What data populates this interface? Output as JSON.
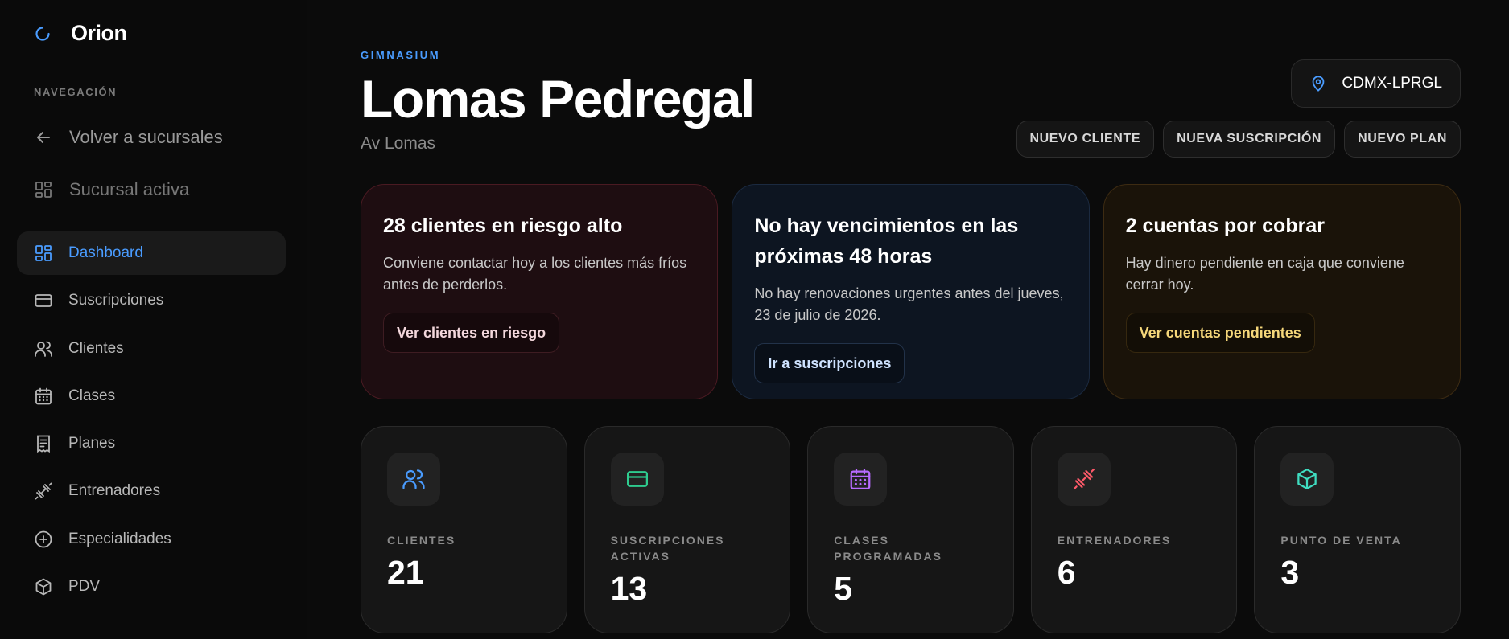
{
  "brand": {
    "name": "Orion",
    "icon": "loader-ring-icon",
    "accent": "#4a9cff"
  },
  "sidebar": {
    "section_label": "NAVEGACIÓN",
    "back_label": "Volver a sucursales",
    "active_branch_label": "Sucursal activa",
    "items": [
      {
        "label": "Dashboard",
        "icon": "dashboard-icon",
        "active": true
      },
      {
        "label": "Suscripciones",
        "icon": "credit-card-icon",
        "active": false
      },
      {
        "label": "Clientes",
        "icon": "users-icon",
        "active": false
      },
      {
        "label": "Clases",
        "icon": "calendar-icon",
        "active": false
      },
      {
        "label": "Planes",
        "icon": "receipt-icon",
        "active": false
      },
      {
        "label": "Entrenadores",
        "icon": "dumbbell-icon",
        "active": false
      },
      {
        "label": "Especialidades",
        "icon": "plus-circle-icon",
        "active": false
      },
      {
        "label": "PDV",
        "icon": "box-icon",
        "active": false
      }
    ]
  },
  "header": {
    "eyebrow": "GIMNASIUM",
    "title": "Lomas Pedregal",
    "subtitle": "Av Lomas",
    "branch_code": "CDMX-LPRGL",
    "actions": {
      "new_client": "NUEVO CLIENTE",
      "new_subscription": "NUEVA SUSCRIPCIÓN",
      "new_plan": "NUEVO PLAN"
    }
  },
  "alerts": [
    {
      "tone": "red",
      "title": "28 clientes en riesgo alto",
      "body": "Conviene contactar hoy a los clientes más fríos antes de perderlos.",
      "cta": "Ver clientes en riesgo"
    },
    {
      "tone": "blue",
      "title": "No hay vencimientos en las próximas 48 horas",
      "body": "No hay renovaciones urgentes antes del jueves, 23 de julio de 2026.",
      "cta": "Ir a suscripciones"
    },
    {
      "tone": "amber",
      "title": "2 cuentas por cobrar",
      "body": "Hay dinero pendiente en caja que conviene cerrar hoy.",
      "cta": "Ver cuentas pendientes"
    }
  ],
  "stats": [
    {
      "label": "CLIENTES",
      "value": "21",
      "icon": "users-icon",
      "color": "#4a9cff"
    },
    {
      "label": "SUSCRIPCIONES ACTIVAS",
      "value": "13",
      "icon": "credit-card-icon",
      "color": "#2ecc8f"
    },
    {
      "label": "CLASES PROGRAMADAS",
      "value": "5",
      "icon": "calendar-icon",
      "color": "#b86bff"
    },
    {
      "label": "ENTRENADORES",
      "value": "6",
      "icon": "dumbbell-icon",
      "color": "#ff5a6a"
    },
    {
      "label": "PUNTO DE VENTA",
      "value": "3",
      "icon": "box-icon",
      "color": "#3fdcc0"
    }
  ]
}
